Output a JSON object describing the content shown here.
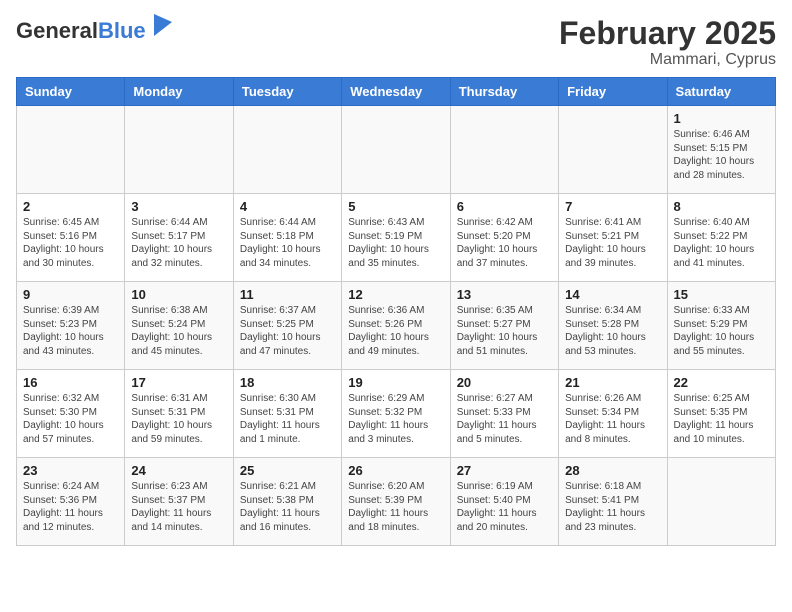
{
  "header": {
    "logo_general": "General",
    "logo_blue": "Blue",
    "title": "February 2025",
    "subtitle": "Mammari, Cyprus"
  },
  "days_of_week": [
    "Sunday",
    "Monday",
    "Tuesday",
    "Wednesday",
    "Thursday",
    "Friday",
    "Saturday"
  ],
  "weeks": [
    [
      {
        "day": "",
        "info": ""
      },
      {
        "day": "",
        "info": ""
      },
      {
        "day": "",
        "info": ""
      },
      {
        "day": "",
        "info": ""
      },
      {
        "day": "",
        "info": ""
      },
      {
        "day": "",
        "info": ""
      },
      {
        "day": "1",
        "info": "Sunrise: 6:46 AM\nSunset: 5:15 PM\nDaylight: 10 hours\nand 28 minutes."
      }
    ],
    [
      {
        "day": "2",
        "info": "Sunrise: 6:45 AM\nSunset: 5:16 PM\nDaylight: 10 hours\nand 30 minutes."
      },
      {
        "day": "3",
        "info": "Sunrise: 6:44 AM\nSunset: 5:17 PM\nDaylight: 10 hours\nand 32 minutes."
      },
      {
        "day": "4",
        "info": "Sunrise: 6:44 AM\nSunset: 5:18 PM\nDaylight: 10 hours\nand 34 minutes."
      },
      {
        "day": "5",
        "info": "Sunrise: 6:43 AM\nSunset: 5:19 PM\nDaylight: 10 hours\nand 35 minutes."
      },
      {
        "day": "6",
        "info": "Sunrise: 6:42 AM\nSunset: 5:20 PM\nDaylight: 10 hours\nand 37 minutes."
      },
      {
        "day": "7",
        "info": "Sunrise: 6:41 AM\nSunset: 5:21 PM\nDaylight: 10 hours\nand 39 minutes."
      },
      {
        "day": "8",
        "info": "Sunrise: 6:40 AM\nSunset: 5:22 PM\nDaylight: 10 hours\nand 41 minutes."
      }
    ],
    [
      {
        "day": "9",
        "info": "Sunrise: 6:39 AM\nSunset: 5:23 PM\nDaylight: 10 hours\nand 43 minutes."
      },
      {
        "day": "10",
        "info": "Sunrise: 6:38 AM\nSunset: 5:24 PM\nDaylight: 10 hours\nand 45 minutes."
      },
      {
        "day": "11",
        "info": "Sunrise: 6:37 AM\nSunset: 5:25 PM\nDaylight: 10 hours\nand 47 minutes."
      },
      {
        "day": "12",
        "info": "Sunrise: 6:36 AM\nSunset: 5:26 PM\nDaylight: 10 hours\nand 49 minutes."
      },
      {
        "day": "13",
        "info": "Sunrise: 6:35 AM\nSunset: 5:27 PM\nDaylight: 10 hours\nand 51 minutes."
      },
      {
        "day": "14",
        "info": "Sunrise: 6:34 AM\nSunset: 5:28 PM\nDaylight: 10 hours\nand 53 minutes."
      },
      {
        "day": "15",
        "info": "Sunrise: 6:33 AM\nSunset: 5:29 PM\nDaylight: 10 hours\nand 55 minutes."
      }
    ],
    [
      {
        "day": "16",
        "info": "Sunrise: 6:32 AM\nSunset: 5:30 PM\nDaylight: 10 hours\nand 57 minutes."
      },
      {
        "day": "17",
        "info": "Sunrise: 6:31 AM\nSunset: 5:31 PM\nDaylight: 10 hours\nand 59 minutes."
      },
      {
        "day": "18",
        "info": "Sunrise: 6:30 AM\nSunset: 5:31 PM\nDaylight: 11 hours\nand 1 minute."
      },
      {
        "day": "19",
        "info": "Sunrise: 6:29 AM\nSunset: 5:32 PM\nDaylight: 11 hours\nand 3 minutes."
      },
      {
        "day": "20",
        "info": "Sunrise: 6:27 AM\nSunset: 5:33 PM\nDaylight: 11 hours\nand 5 minutes."
      },
      {
        "day": "21",
        "info": "Sunrise: 6:26 AM\nSunset: 5:34 PM\nDaylight: 11 hours\nand 8 minutes."
      },
      {
        "day": "22",
        "info": "Sunrise: 6:25 AM\nSunset: 5:35 PM\nDaylight: 11 hours\nand 10 minutes."
      }
    ],
    [
      {
        "day": "23",
        "info": "Sunrise: 6:24 AM\nSunset: 5:36 PM\nDaylight: 11 hours\nand 12 minutes."
      },
      {
        "day": "24",
        "info": "Sunrise: 6:23 AM\nSunset: 5:37 PM\nDaylight: 11 hours\nand 14 minutes."
      },
      {
        "day": "25",
        "info": "Sunrise: 6:21 AM\nSunset: 5:38 PM\nDaylight: 11 hours\nand 16 minutes."
      },
      {
        "day": "26",
        "info": "Sunrise: 6:20 AM\nSunset: 5:39 PM\nDaylight: 11 hours\nand 18 minutes."
      },
      {
        "day": "27",
        "info": "Sunrise: 6:19 AM\nSunset: 5:40 PM\nDaylight: 11 hours\nand 20 minutes."
      },
      {
        "day": "28",
        "info": "Sunrise: 6:18 AM\nSunset: 5:41 PM\nDaylight: 11 hours\nand 23 minutes."
      },
      {
        "day": "",
        "info": ""
      }
    ]
  ]
}
